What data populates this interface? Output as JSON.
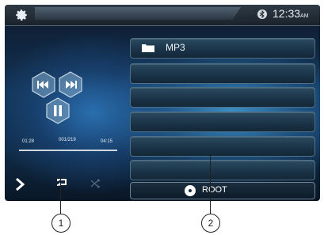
{
  "status_bar": {
    "settings_icon": "gear-icon",
    "bluetooth_icon": "bluetooth-icon",
    "time": "12:33",
    "ampm": "AM"
  },
  "player": {
    "controls": [
      "previous-track-icon",
      "next-track-icon",
      "pause-icon"
    ],
    "elapsed": "01:28",
    "track": "001/219",
    "total": "04:15"
  },
  "bottom_controls": {
    "menu_icon": "chevron-right-icon",
    "repeat_icon": "repeat-icon",
    "shuffle_icon": "shuffle-icon"
  },
  "browser": {
    "rows": [
      {
        "label": "MP3",
        "icon": "folder-icon"
      },
      {
        "label": ""
      },
      {
        "label": ""
      },
      {
        "label": ""
      },
      {
        "label": ""
      },
      {
        "label": ""
      }
    ],
    "root_label": "ROOT"
  },
  "callouts": [
    "1",
    "2"
  ]
}
